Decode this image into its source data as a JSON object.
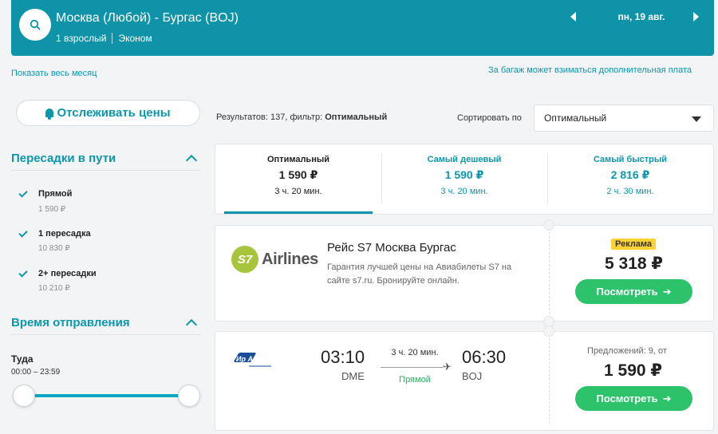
{
  "header": {
    "route": "Москва (Любой) - Бургас (BOJ)",
    "passengers": "1 взрослый",
    "class": "Эконом",
    "date": "пн, 19 авг."
  },
  "links": {
    "show_month": "Показать весь месяц",
    "baggage": "За багаж может взиматься дополнительная плата"
  },
  "sidebar": {
    "track_prices": "Отслеживать цены",
    "transfers": {
      "title": "Пересадки в пути",
      "options": [
        {
          "label": "Прямой",
          "price": "1 590 ₽"
        },
        {
          "label": "1 пересадка",
          "price": "10 830 ₽"
        },
        {
          "label": "2+ пересадки",
          "price": "10 210 ₽"
        }
      ]
    },
    "departure": {
      "title": "Время отправления",
      "direction": "Туда",
      "range": "00:00 – 23:59"
    }
  },
  "results": {
    "prefix": "Результатов: 137, фильтр:",
    "filter": "Оптимальный",
    "sort_label": "Сортировать по",
    "sort_value": "Оптимальный"
  },
  "tabs": [
    {
      "name": "Оптимальный",
      "price": "1 590 ₽",
      "time": "3 ч. 20 мин."
    },
    {
      "name": "Самый дешевый",
      "price": "1 590 ₽",
      "time": "3 ч. 20 мин."
    },
    {
      "name": "Самый быстрый",
      "price": "2 816 ₽",
      "time": "2 ч. 30 мин."
    }
  ],
  "ad": {
    "logo_mark": "S7",
    "logo_text": "Airlines",
    "title": "Рейс S7 Москва Бургас",
    "description": "Гарантия лучшей цены на Авиабилеты S7 на сайте s7.ru. Бронируйте онлайн.",
    "badge": "Реклама",
    "price": "5 318 ₽",
    "button": "Посмотреть"
  },
  "flight": {
    "airline_logo_text": "Ир Аэро",
    "dep_time": "03:10",
    "dep_code": "DME",
    "arr_time": "06:30",
    "arr_code": "BOJ",
    "duration": "3 ч. 20 мин.",
    "stops": "Прямой",
    "offers": "Предложений: 9, от",
    "price": "1 590 ₽",
    "button": "Посмотреть"
  },
  "colors": {
    "brand": "#0f93a8",
    "accent_text": "#0c97ad",
    "button_green": "#2cc36b",
    "badge_yellow": "#ffd233"
  }
}
